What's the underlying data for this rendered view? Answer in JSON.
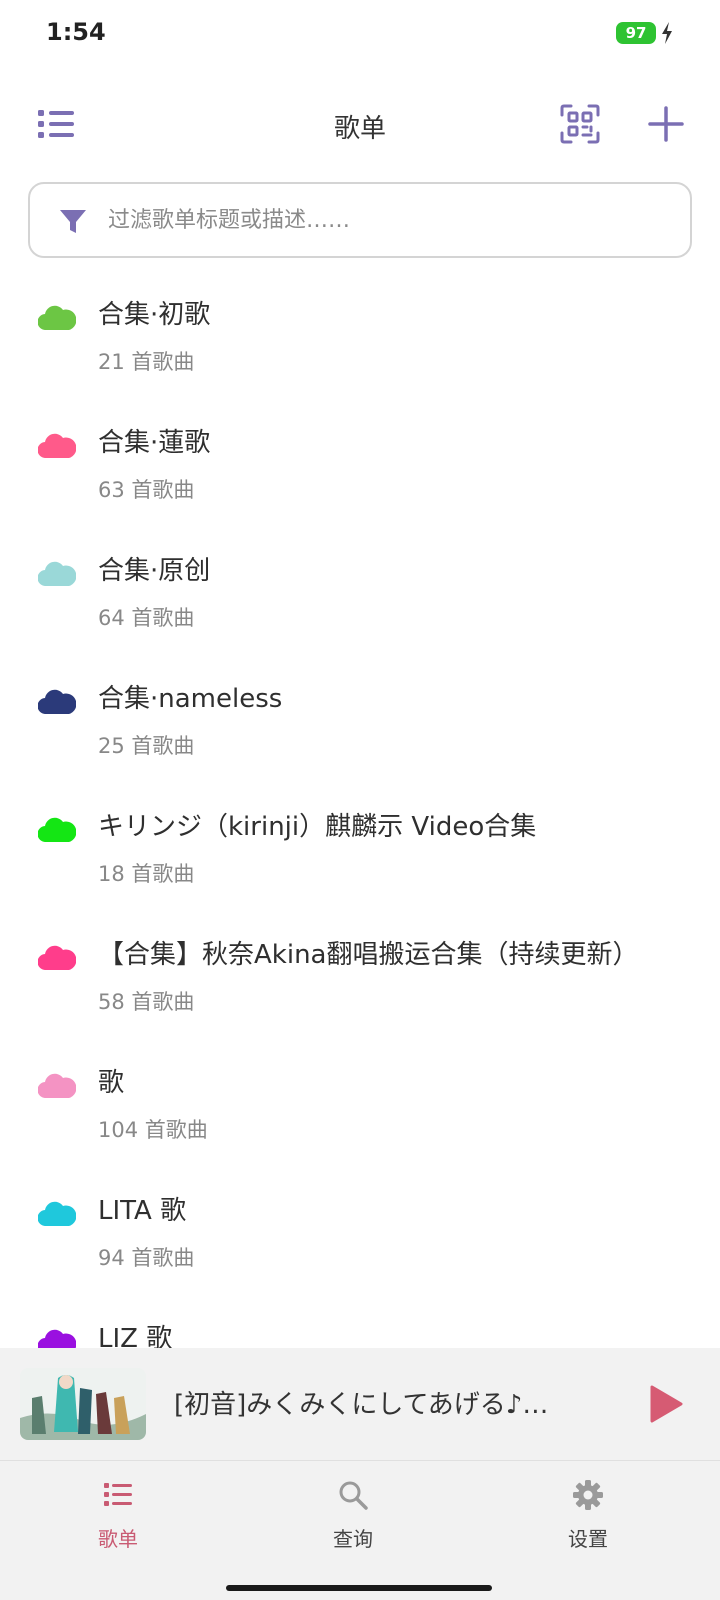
{
  "status_bar": {
    "time": "1:54",
    "battery": "97"
  },
  "header": {
    "title": "歌单"
  },
  "filter": {
    "placeholder": "过滤歌单标题或描述……"
  },
  "playlists": [
    {
      "title": "合集·初歌",
      "count": "21 首歌曲",
      "color": "#6cc644"
    },
    {
      "title": "合集·蓮歌",
      "count": "63 首歌曲",
      "color": "#ff5a8a"
    },
    {
      "title": "合集·原创",
      "count": "64 首歌曲",
      "color": "#9ad8d8"
    },
    {
      "title": "合集·nameless",
      "count": "25 首歌曲",
      "color": "#2b3a7a"
    },
    {
      "title": "キリンジ（kirinji）麒麟示 Video合集",
      "count": "18 首歌曲",
      "color": "#14e614"
    },
    {
      "title": "【合集】秋奈Akina翻唱搬运合集（持续更新）",
      "count": "58 首歌曲",
      "color": "#ff3d8b"
    },
    {
      "title": "歌",
      "count": "104 首歌曲",
      "color": "#f493c3"
    },
    {
      "title": "LITA 歌",
      "count": "94 首歌曲",
      "color": "#1fc8dc"
    },
    {
      "title": "LIZ 歌",
      "count": "",
      "color": "#9a10e0"
    }
  ],
  "player": {
    "title": "[初音]みくみくにしてあげる♪…"
  },
  "bottom_nav": [
    {
      "label": "歌单",
      "icon": "list-icon",
      "active": true
    },
    {
      "label": "查询",
      "icon": "search-icon",
      "active": false
    },
    {
      "label": "设置",
      "icon": "gear-icon",
      "active": false
    }
  ],
  "colors": {
    "accent": "#7b6fb3",
    "active_tab": "#c95b73",
    "play": "#d65b73"
  }
}
